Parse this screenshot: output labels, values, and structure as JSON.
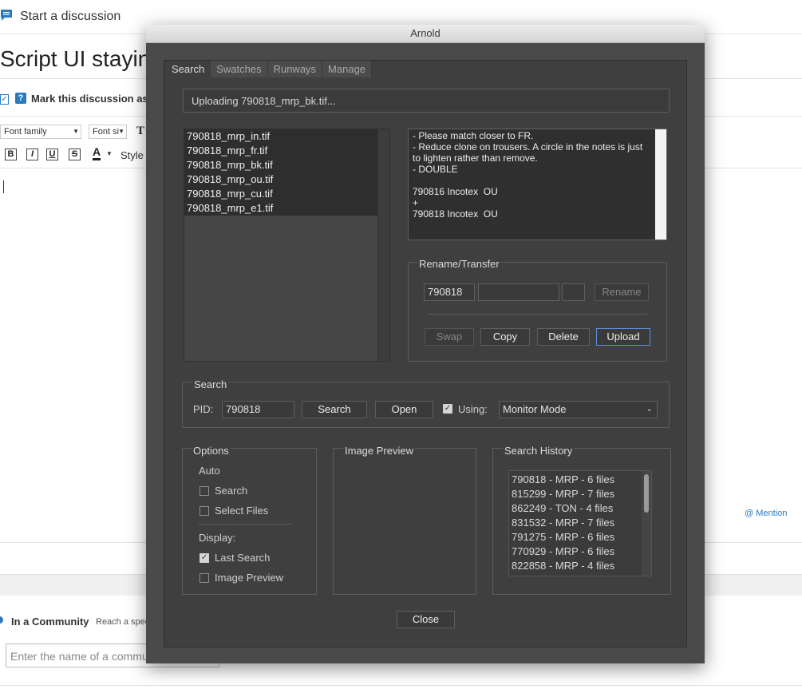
{
  "background_page": {
    "header_link": "Start a discussion",
    "title": "Script UI stayin",
    "mark_label": "Mark this discussion as a",
    "font_family": "Font family",
    "font_size": "Font si",
    "tt_glyph": "T",
    "bold": "B",
    "italic": "I",
    "underline": "U",
    "strike": "S",
    "font_color": "A",
    "style": "Style",
    "mention": "@ Mention",
    "community_label": "In a Community",
    "community_desc": "Reach a spec",
    "community_placeholder": "Enter the name of a commu"
  },
  "dialog": {
    "title": "Arnold",
    "tabs": [
      "Search",
      "Swatches",
      "Runways",
      "Manage"
    ],
    "active_tab": "Search",
    "status": "Uploading 790818_mrp_bk.tif...",
    "files": [
      "790818_mrp_in.tif",
      "790818_mrp_fr.tif",
      "790818_mrp_bk.tif",
      "790818_mrp_ou.tif",
      "790818_mrp_cu.tif",
      "790818_mrp_e1.tif"
    ],
    "notes": "- Please match closer to FR.\n- Reduce clone on trousers. A circle in the notes is just to lighten rather than remove.\n- DOUBLE\n\n790816 Incotex  OU\n+\n790818 Incotex  OU",
    "rename_transfer": {
      "title": "Rename/Transfer",
      "field1": "790818",
      "field2": "",
      "field3": "",
      "rename": "Rename",
      "swap": "Swap",
      "copy": "Copy",
      "delete": "Delete",
      "upload": "Upload"
    },
    "search": {
      "title": "Search",
      "pid_label": "PID:",
      "pid_value": "790818",
      "search_btn": "Search",
      "open_btn": "Open",
      "using_label": "Using:",
      "using_checked": true,
      "mode": "Monitor Mode"
    },
    "options": {
      "title": "Options",
      "auto_label": "Auto",
      "auto_search": "Search",
      "auto_select_files": "Select Files",
      "display_label": "Display:",
      "last_search": "Last Search",
      "image_preview": "Image Preview",
      "auto_search_checked": false,
      "auto_select_checked": false,
      "last_search_checked": true,
      "image_preview_checked": false
    },
    "image_preview": {
      "title": "Image Preview"
    },
    "history": {
      "title": "Search History",
      "items": [
        "790818 - MRP - 6 files",
        "815299 - MRP - 7 files",
        "862249 - TON - 4 files",
        "831532 - MRP - 7 files",
        "791275 - MRP - 6 files",
        "770929 - MRP - 6 files",
        "822858 - MRP - 4 files"
      ]
    },
    "close": "Close"
  },
  "colors": {
    "window_bg": "#4a4a4a",
    "panel_bg": "#3f3f3f",
    "accent_blue": "#2a7ac0",
    "focus_border": "#5d8fd8"
  }
}
